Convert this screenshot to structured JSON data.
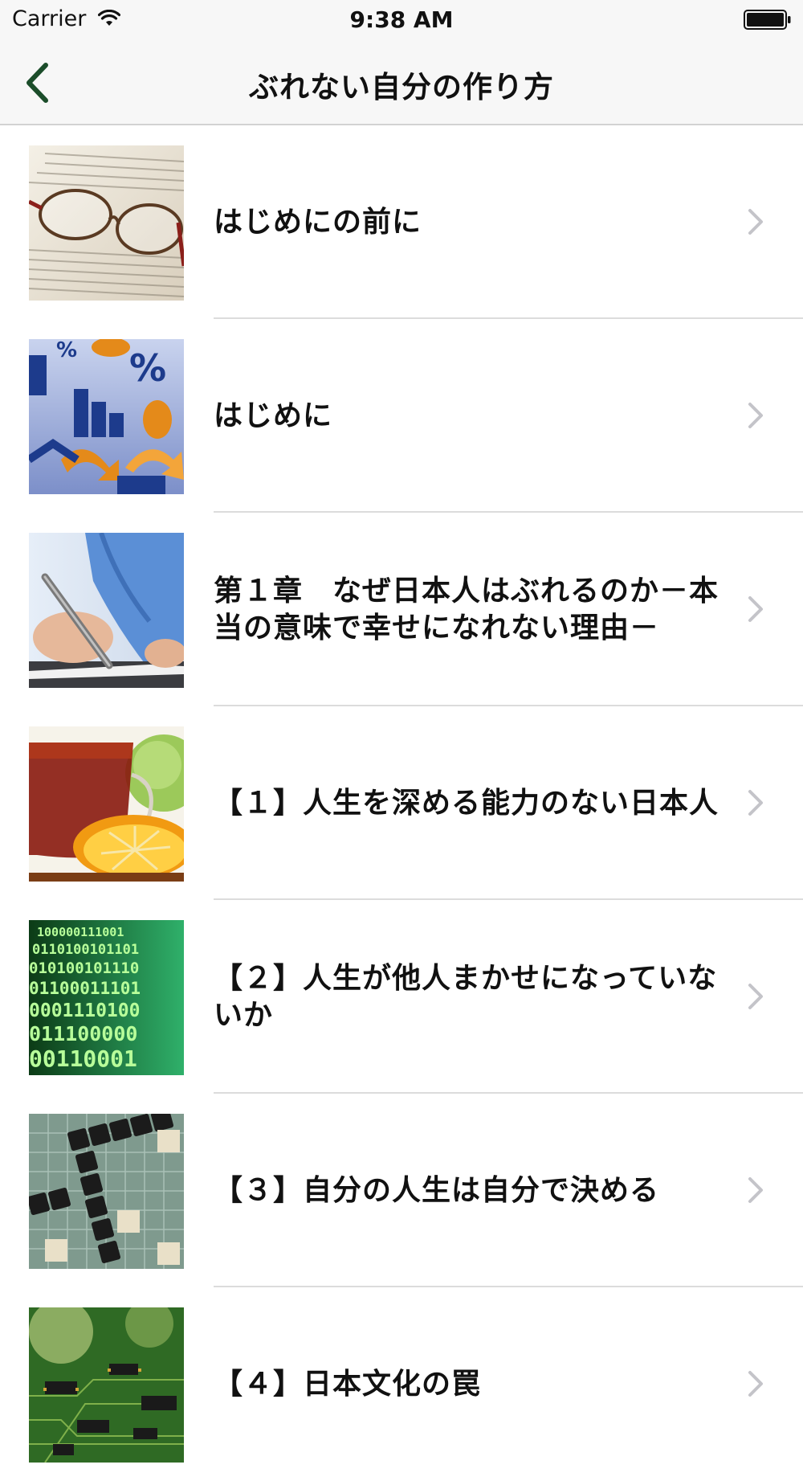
{
  "status_bar": {
    "carrier": "Carrier",
    "time": "9:38 AM",
    "wifi_icon": "wifi-icon",
    "battery_icon": "battery-icon"
  },
  "nav": {
    "title": "ぶれない自分の作り方",
    "back_icon": "chevron-left-icon",
    "accent_color": "#1b4d2a"
  },
  "list": {
    "chevron_icon": "chevron-right-icon",
    "items": [
      {
        "label": "はじめにの前に",
        "thumb": "glasses-on-document-image"
      },
      {
        "label": "はじめに",
        "thumb": "charts-and-arrows-image"
      },
      {
        "label": "第１章　なぜ日本人はぶれるのか－本当の意味で幸せになれない理由－",
        "thumb": "hand-writing-image"
      },
      {
        "label": "【１】人生を深める能力のない日本人",
        "thumb": "tea-and-fruit-image"
      },
      {
        "label": "【２】人生が他人まかせになっていないか",
        "thumb": "binary-code-image"
      },
      {
        "label": "【３】自分の人生は自分で決める",
        "thumb": "success-scrabble-image"
      },
      {
        "label": "【４】日本文化の罠",
        "thumb": "circuit-board-image"
      }
    ]
  }
}
